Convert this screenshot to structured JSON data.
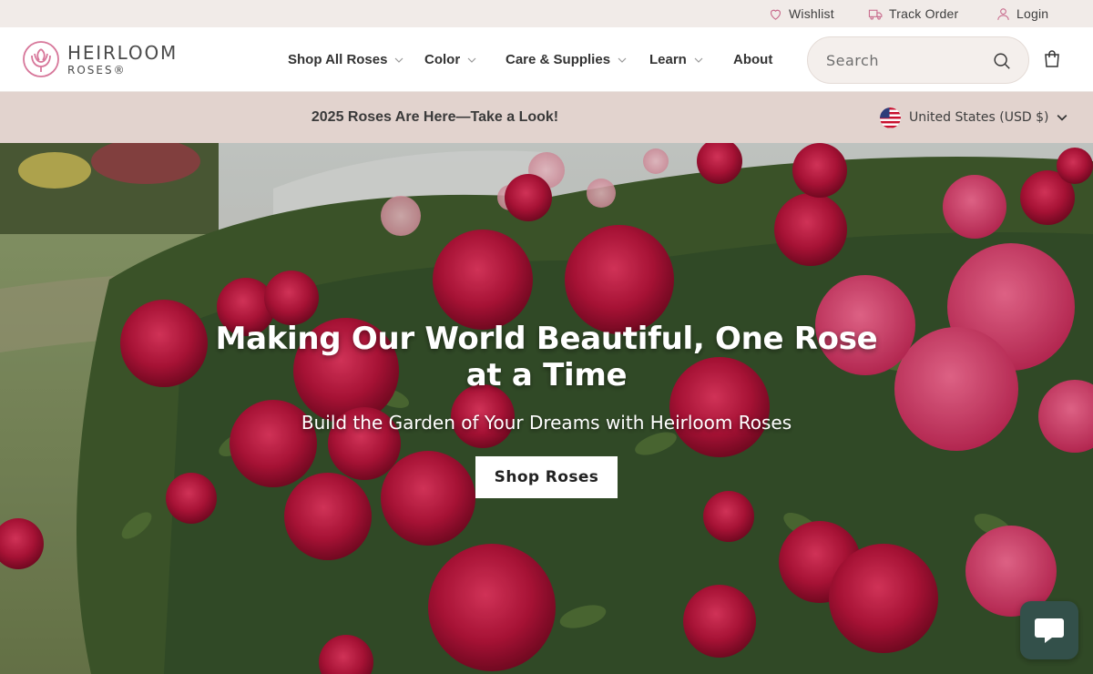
{
  "utility": {
    "wishlist_label": "Wishlist",
    "track_order_label": "Track Order",
    "login_label": "Login"
  },
  "logo": {
    "line1": "HEIRLOOM",
    "line2": "ROSES®"
  },
  "nav": {
    "items": [
      {
        "label": "Shop All Roses",
        "has_dropdown": true
      },
      {
        "label": "Color",
        "has_dropdown": true
      },
      {
        "label": "Care & Supplies",
        "has_dropdown": true
      },
      {
        "label": "Learn",
        "has_dropdown": true
      },
      {
        "label": "About",
        "has_dropdown": false
      }
    ]
  },
  "search": {
    "placeholder": "Search",
    "value": ""
  },
  "announcement": {
    "text": "2025 Roses Are Here—Take a Look!"
  },
  "locale": {
    "country_label": "United States (USD $)"
  },
  "hero": {
    "title": "Making Our World Beautiful, One Rose at a Time",
    "subtitle": "Build the Garden of Your Dreams with Heirloom Roses",
    "button_label": "Shop Roses"
  },
  "colors": {
    "utility_bg": "#f1ebe8",
    "announcement_bg": "#e2d3ce",
    "brand_pink": "#d7779a",
    "chat_button": "#33504a"
  },
  "icons": [
    "heart-icon",
    "truck-icon",
    "user-icon",
    "search-icon",
    "cart-icon",
    "chevron-down-icon",
    "us-flag-icon",
    "chat-icon"
  ]
}
